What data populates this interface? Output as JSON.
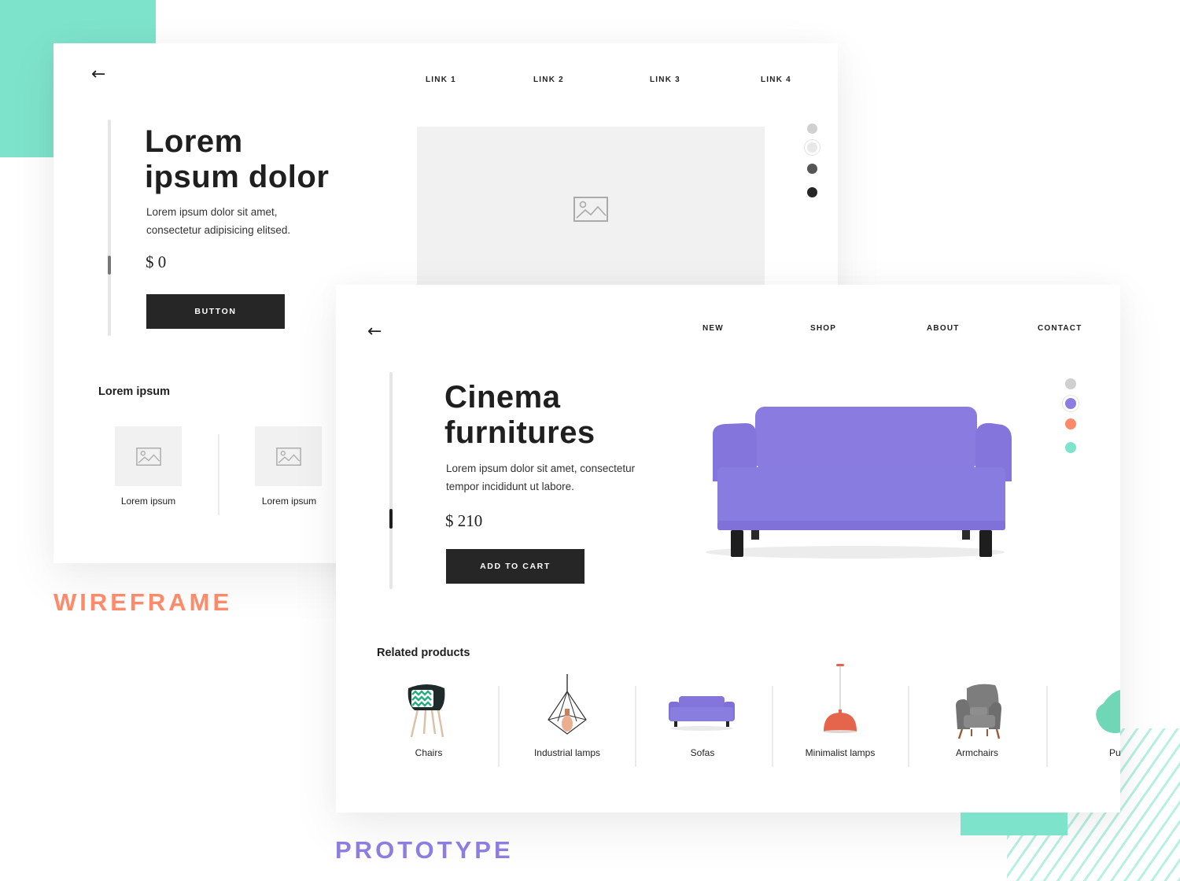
{
  "colors": {
    "accent_teal": "#7ee3cb",
    "accent_coral": "#ff8a6a",
    "accent_purple": "#8b7ee0",
    "dark": "#262626"
  },
  "wireframe": {
    "caption": "WIREFRAME",
    "back_icon": "arrow-left-icon",
    "nav": [
      "LINK 1",
      "LINK 2",
      "LINK 3",
      "LINK 4"
    ],
    "hero": {
      "title_line1": "Lorem",
      "title_line2": "ipsum dolor",
      "desc_line1": "Lorem ipsum dolor sit amet,",
      "desc_line2": "consectetur adipisicing elitsed.",
      "price": "$ 0",
      "button": "BUTTON",
      "image_icon": "image-placeholder-icon"
    },
    "swatches": [
      "#d0d0d0",
      "#e8e8e8",
      "#555555",
      "#262626"
    ],
    "selected_swatch": 1,
    "related": {
      "title": "Lorem ipsum",
      "items": [
        {
          "label": "Lorem ipsum",
          "icon": "image-placeholder-icon"
        },
        {
          "label": "Lorem ipsum",
          "icon": "image-placeholder-icon"
        }
      ]
    }
  },
  "prototype": {
    "caption": "PROTOTYPE",
    "back_icon": "arrow-left-icon",
    "nav": [
      "NEW",
      "SHOP",
      "ABOUT",
      "CONTACT"
    ],
    "hero": {
      "title_line1": "Cinema",
      "title_line2": "furnitures",
      "desc_line1": "Lorem ipsum dolor sit amet, consectetur",
      "desc_line2": "tempor incididunt ut labore.",
      "price": "$ 210",
      "button": "ADD TO CART",
      "image": "purple-sofa"
    },
    "swatches": [
      "#d0d0d0",
      "#8b7ee0",
      "#ff8a6a",
      "#7ee3cb"
    ],
    "selected_swatch": 1,
    "related": {
      "title": "Related products",
      "items": [
        {
          "label": "Chairs",
          "icon": "chair-icon"
        },
        {
          "label": "Industrial lamps",
          "icon": "industrial-lamp-icon"
        },
        {
          "label": "Sofas",
          "icon": "sofa-icon"
        },
        {
          "label": "Minimalist lamps",
          "icon": "minimalist-lamp-icon"
        },
        {
          "label": "Armchairs",
          "icon": "armchair-icon"
        },
        {
          "label": "Pu",
          "icon": "pouf-icon"
        }
      ]
    }
  }
}
